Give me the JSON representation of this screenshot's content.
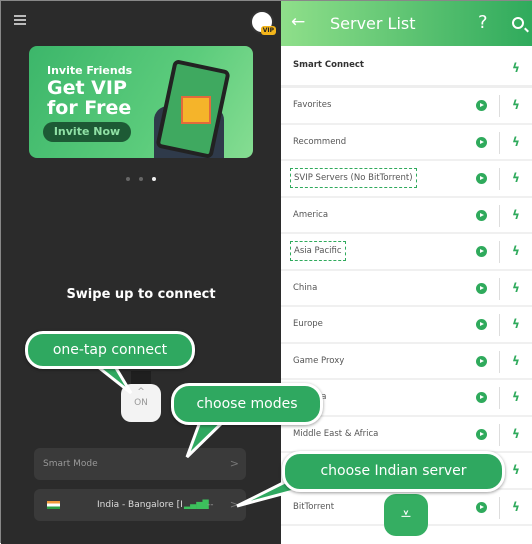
{
  "left": {
    "banner": {
      "line1": "Invite Friends",
      "line2": "Get VIP",
      "line3": "for Free",
      "button": "Invite Now"
    },
    "avatar_badge": "VIP",
    "carousel": {
      "count": 3,
      "active": 3
    },
    "swipe_text": "Swipe up to connect",
    "on_button": "ON",
    "mode": {
      "label": "Smart Mode"
    },
    "server": {
      "name": "India - Bangalore [I",
      "latency": "--"
    }
  },
  "right": {
    "header": {
      "title": "Server List",
      "help": "?"
    },
    "items": [
      {
        "label": "Smart Connect"
      },
      {
        "label": "Favorites"
      },
      {
        "label": "Recommend"
      },
      {
        "label": "SVIP Servers (No BitTorrent)"
      },
      {
        "label": "America"
      },
      {
        "label": "Asia Pacific"
      },
      {
        "label": "China"
      },
      {
        "label": "Europe"
      },
      {
        "label": "Game Proxy"
      },
      {
        "label": "& Korea"
      },
      {
        "label": "Middle East & Africa"
      },
      {
        "label": ""
      },
      {
        "label": "BitTorrent"
      }
    ]
  },
  "callouts": {
    "tap": "one-tap connect",
    "modes": "choose modes",
    "server": "choose Indian server"
  },
  "colors": {
    "accent": "#2fa860",
    "dark_bg": "#2b2b2b"
  }
}
